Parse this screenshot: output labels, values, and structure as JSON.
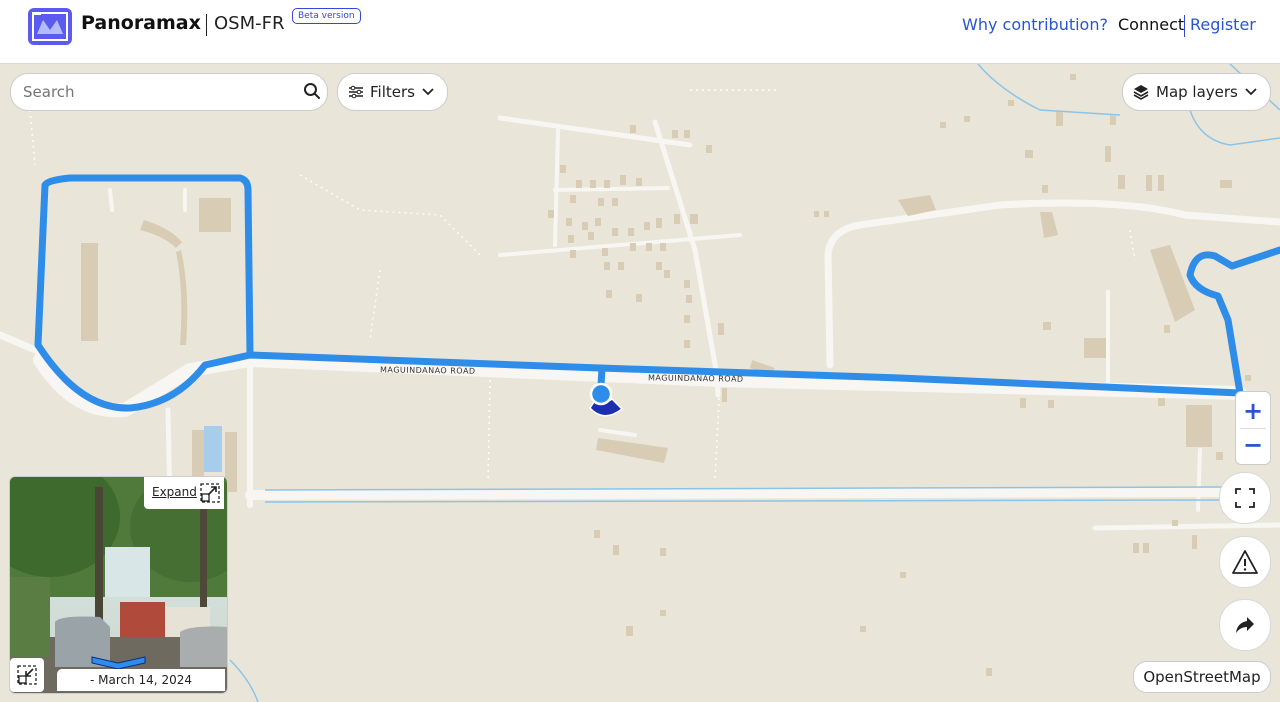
{
  "header": {
    "brand": "Panoramax",
    "instance": "OSM-FR",
    "beta_label": "Beta version",
    "why_link": "Why contribution?",
    "connect": "Connect",
    "register": "Register"
  },
  "search": {
    "placeholder": "Search"
  },
  "filters_label": "Filters",
  "map_layers_label": "Map layers",
  "map": {
    "road_label_1": "MAGUINDANAO ROAD",
    "road_label_2": "MAGUINDANAO ROAD",
    "attribution": "OpenStreetMap",
    "colors": {
      "sequence": "#2e8de8",
      "marker": "#1b2fb0",
      "land": "#e9e5d8"
    }
  },
  "viewer": {
    "expand_label": "Expand",
    "date": "- March 14, 2024"
  },
  "controls": {
    "zoom_in": "+",
    "zoom_out": "−"
  }
}
